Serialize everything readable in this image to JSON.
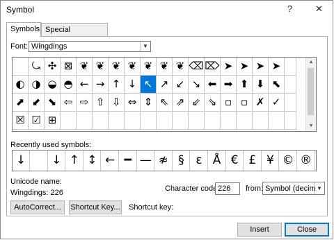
{
  "window": {
    "title": "Symbol",
    "help_glyph": "?",
    "close_glyph": "✕"
  },
  "tabs": [
    {
      "label": "Symbols",
      "active": true
    },
    {
      "label": "Special Characters",
      "active": false
    }
  ],
  "font_label": "Font:",
  "font_value": "Wingdings",
  "symbol_grid": {
    "rows": [
      [
        "⤿",
        "✣",
        "⊠",
        "❦",
        "❦",
        "❦",
        "❦",
        "❦",
        "❦",
        "❦",
        "⌫",
        "⌦",
        "➤",
        "➤",
        "➤",
        "➤"
      ],
      [
        "◐",
        "◑",
        "◒",
        "◓",
        "←",
        "→",
        "↑",
        "↓",
        "↖",
        "↗",
        "↙",
        "↘",
        "⬅",
        "➡",
        "⬆",
        "⬇",
        "⬉"
      ],
      [
        "⬈",
        "⬋",
        "⬊",
        "⇦",
        "⇨",
        "⇧",
        "⇩",
        "⇔",
        "⇕",
        "⇖",
        "⇗",
        "⇙",
        "⇘",
        "▫",
        "▫",
        "✗",
        "✓"
      ],
      [
        "☒",
        "☑",
        "⊞"
      ]
    ],
    "selected": "↓"
  },
  "recent_label": "Recently used symbols:",
  "recent_symbols": [
    "↓",
    "",
    "↓",
    "↑",
    "↕",
    "←",
    "━",
    "—",
    "≉",
    "§",
    "ε",
    "Å",
    "€",
    "£",
    "¥",
    "©",
    "®"
  ],
  "unicode_name_label": "Unicode name:",
  "char_name": "Wingdings: 226",
  "char_code_label": "Character code:",
  "char_code_value": "226",
  "from_label": "from:",
  "from_value": "Symbol (decimal)",
  "buttons": {
    "autocorrect": "AutoCorrect...",
    "shortcut_key": "Shortcut Key...",
    "insert": "Insert",
    "close": "Close"
  },
  "shortcut_key_label": "Shortcut key:"
}
